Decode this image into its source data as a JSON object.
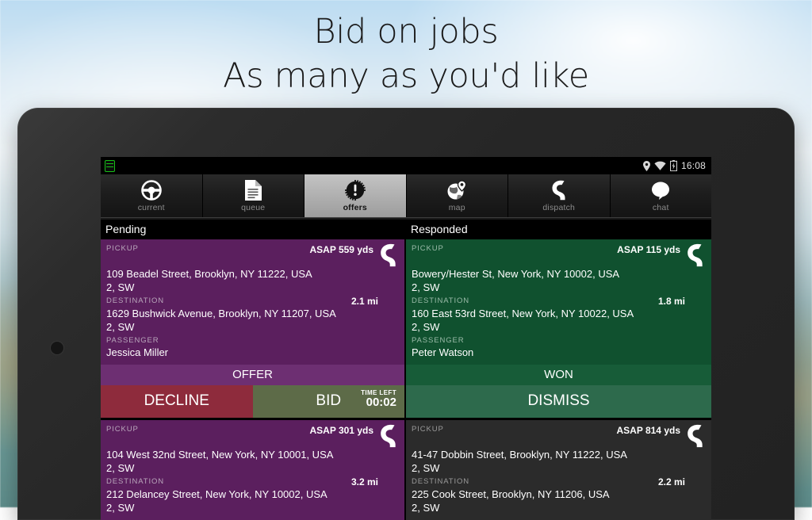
{
  "headline": {
    "line1": "Bid on jobs",
    "line2": "As many as you'd like"
  },
  "device": {
    "camera": "front-camera"
  },
  "statusbar": {
    "sim_icon": "sim-card-icon",
    "location_icon": "location-pin-icon",
    "wifi_icon": "wifi-icon",
    "battery_icon": "battery-icon",
    "clock": "16:08"
  },
  "tabs": [
    {
      "id": "current",
      "label": "current",
      "icon": "steering-wheel-icon",
      "active": false
    },
    {
      "id": "queue",
      "label": "queue",
      "icon": "document-icon",
      "active": false
    },
    {
      "id": "offers",
      "label": "offers",
      "icon": "alert-badge-icon",
      "active": true
    },
    {
      "id": "map",
      "label": "map",
      "icon": "globe-pin-icon",
      "active": false
    },
    {
      "id": "dispatch",
      "label": "dispatch",
      "icon": "phone-handset-icon",
      "active": false
    },
    {
      "id": "chat",
      "label": "chat",
      "icon": "speech-bubble-icon",
      "active": false
    }
  ],
  "labels": {
    "pickup": "PICKUP",
    "destination": "DESTINATION",
    "passenger": "PASSENGER",
    "time_left": "TIME LEFT"
  },
  "columns": [
    {
      "title": "Pending",
      "cards": [
        {
          "theme": "purple",
          "asap": "ASAP 559 yds",
          "miles": "2.1 mi",
          "pickup_address": "109 Beadel Street, Brooklyn, NY 11222, USA",
          "pickup_sub": "2, SW",
          "destination_address": "1629 Bushwick Avenue, Brooklyn, NY 11207, USA",
          "destination_sub": "2, SW",
          "passenger": "Jessica Miller",
          "status": "OFFER",
          "buttons": [
            {
              "id": "decline",
              "label": "DECLINE"
            },
            {
              "id": "bid",
              "label": "BID",
              "time_left": "00:02"
            }
          ]
        },
        {
          "theme": "purple",
          "asap": "ASAP  301 yds",
          "miles": "3.2 mi",
          "pickup_address": "104 West 32nd Street, New York, NY 10001, USA",
          "pickup_sub": "2, SW",
          "destination_address": "212 Delancey Street, New York, NY 10002, USA",
          "destination_sub": "2, SW"
        }
      ]
    },
    {
      "title": "Responded",
      "cards": [
        {
          "theme": "green",
          "asap": "ASAP 115 yds",
          "miles": "1.8 mi",
          "pickup_address": "Bowery/Hester St, New York, NY 10002, USA",
          "pickup_sub": "2, SW",
          "destination_address": "160 East 53rd Street, New York, NY 10022, USA",
          "destination_sub": "2, SW",
          "passenger": "Peter Watson",
          "status": "WON",
          "buttons": [
            {
              "id": "dismiss",
              "label": "DISMISS"
            }
          ]
        },
        {
          "theme": "grey",
          "asap": "ASAP 814 yds",
          "miles": "2.2 mi",
          "pickup_address": "41-47 Dobbin Street, Brooklyn, NY 11222, USA",
          "pickup_sub": "2, SW",
          "destination_address": "225 Cook Street, Brooklyn, NY 11206, USA",
          "destination_sub": "2, SW"
        }
      ]
    }
  ],
  "colors": {
    "pending_card": "#5b1f5e",
    "offer_strip": "#6d2f72",
    "decline_button": "#8e2b3c",
    "bid_button": "#5d6b48",
    "responded_card": "#10512f",
    "won_strip": "#175c38",
    "dismiss_button": "#2d6a4c",
    "inactive_card": "#2b2b2b",
    "sim_green": "#17c217"
  }
}
